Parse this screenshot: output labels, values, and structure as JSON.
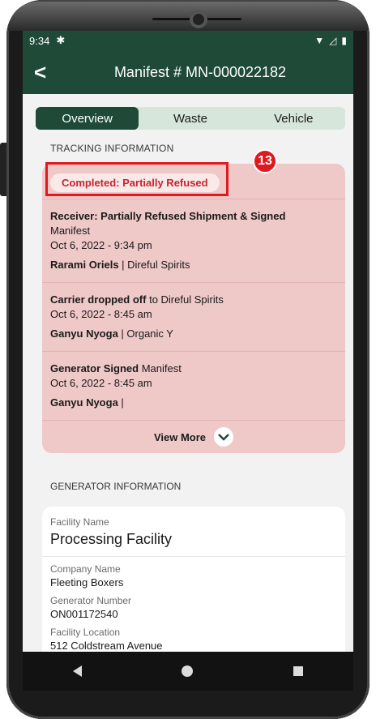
{
  "status_bar": {
    "time": "9:34",
    "settings_icon": "gear-icon",
    "signal_icons": "wifi-signal-battery"
  },
  "app_bar": {
    "title": "Manifest # MN-000022182",
    "back_icon": "chevron-left-icon"
  },
  "tabs": [
    {
      "label": "Overview",
      "active": true
    },
    {
      "label": "Waste",
      "active": false
    },
    {
      "label": "Vehicle",
      "active": false
    }
  ],
  "tracking": {
    "section_label": "TRACKING INFORMATION",
    "status_badge": "Completed: Partially Refused",
    "marker_number": "13",
    "events": [
      {
        "title": "Receiver: Partially Refused Shipment & Signed",
        "subtitle": "Manifest",
        "date": "Oct 6, 2022 - 9:34 pm",
        "person": "Rarami Oriels",
        "company": "| Direful Spirits"
      },
      {
        "title": "Carrier dropped off",
        "subtitle": " to Direful Spirits",
        "date": "Oct 6, 2022 - 8:45 am",
        "person": "Ganyu Nyoga",
        "company": "| Organic Y"
      },
      {
        "title": "Generator Signed",
        "subtitle": " Manifest",
        "date": "Oct 6, 2022 - 8:45 am",
        "person": "Ganyu Nyoga",
        "company": "|"
      }
    ],
    "view_more": "View More"
  },
  "generator": {
    "section_label": "GENERATOR INFORMATION",
    "facility_name_label": "Facility Name",
    "facility_name": "Processing Facility",
    "company_name_label": "Company Name",
    "company_name": "Fleeting Boxers",
    "generator_number_label": "Generator Number",
    "generator_number": "ON001172540",
    "facility_location_label": "Facility Location",
    "facility_location": "512 Coldstream Avenue"
  },
  "colors": {
    "primary": "#1f4a37",
    "tab_bg": "#d7e6da",
    "tracking_bg": "#efc8c8",
    "status_red": "#c6242c",
    "highlight": "#e0191f"
  }
}
